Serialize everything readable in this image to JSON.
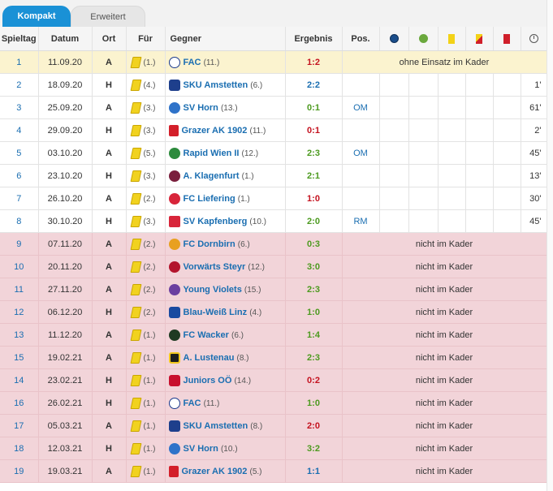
{
  "tabs": {
    "compact": "Kompakt",
    "extended": "Erweitert"
  },
  "headers": {
    "round": "Spieltag",
    "date": "Datum",
    "venue": "Ort",
    "for": "Für",
    "opponent": "Gegner",
    "result": "Ergebnis",
    "position": "Pos."
  },
  "header_icons": [
    "goals-ball-icon",
    "assists-icon",
    "yellow-card-icon",
    "yellow-red-card-icon",
    "red-card-icon",
    "clock-icon"
  ],
  "rows": [
    {
      "round": "1",
      "date": "11.09.20",
      "venue": "A",
      "for_rank": "(1.)",
      "opponent": "FAC",
      "opp_rank": "(11.)",
      "result": "1:2",
      "outcome": "loss",
      "position": "",
      "minutes": "",
      "note": "ohne Einsatz im Kader",
      "status": "highlight",
      "logo": "fac"
    },
    {
      "round": "2",
      "date": "18.09.20",
      "venue": "H",
      "for_rank": "(4.)",
      "opponent": "SKU Amstetten",
      "opp_rank": "(6.)",
      "result": "2:2",
      "outcome": "draw",
      "position": "",
      "minutes": "1'",
      "note": "",
      "status": "normal",
      "logo": "sku"
    },
    {
      "round": "3",
      "date": "25.09.20",
      "venue": "A",
      "for_rank": "(3.)",
      "opponent": "SV Horn",
      "opp_rank": "(13.)",
      "result": "0:1",
      "outcome": "win",
      "position": "OM",
      "minutes": "61'",
      "note": "",
      "status": "normal",
      "logo": "horn"
    },
    {
      "round": "4",
      "date": "29.09.20",
      "venue": "H",
      "for_rank": "(3.)",
      "opponent": "Grazer AK 1902",
      "opp_rank": "(11.)",
      "result": "0:1",
      "outcome": "loss",
      "position": "",
      "minutes": "2'",
      "note": "",
      "status": "normal",
      "logo": "gak"
    },
    {
      "round": "5",
      "date": "03.10.20",
      "venue": "A",
      "for_rank": "(5.)",
      "opponent": "Rapid Wien II",
      "opp_rank": "(12.)",
      "result": "2:3",
      "outcome": "win",
      "position": "OM",
      "minutes": "45'",
      "note": "",
      "status": "normal",
      "logo": "rapid"
    },
    {
      "round": "6",
      "date": "23.10.20",
      "venue": "H",
      "for_rank": "(3.)",
      "opponent": "A. Klagenfurt",
      "opp_rank": "(1.)",
      "result": "2:1",
      "outcome": "win",
      "position": "",
      "minutes": "13'",
      "note": "",
      "status": "normal",
      "logo": "klagenfurt"
    },
    {
      "round": "7",
      "date": "26.10.20",
      "venue": "A",
      "for_rank": "(2.)",
      "opponent": "FC Liefering",
      "opp_rank": "(1.)",
      "result": "1:0",
      "outcome": "loss",
      "position": "",
      "minutes": "30'",
      "note": "",
      "status": "normal",
      "logo": "liefering"
    },
    {
      "round": "8",
      "date": "30.10.20",
      "venue": "H",
      "for_rank": "(3.)",
      "opponent": "SV Kapfenberg",
      "opp_rank": "(10.)",
      "result": "2:0",
      "outcome": "win",
      "position": "RM",
      "minutes": "45'",
      "note": "",
      "status": "normal",
      "logo": "kapfenberg"
    },
    {
      "round": "9",
      "date": "07.11.20",
      "venue": "A",
      "for_rank": "(2.)",
      "opponent": "FC Dornbirn",
      "opp_rank": "(6.)",
      "result": "0:3",
      "outcome": "win",
      "position": "",
      "minutes": "",
      "note": "nicht im Kader",
      "status": "absent",
      "logo": "dornbirn"
    },
    {
      "round": "10",
      "date": "20.11.20",
      "venue": "A",
      "for_rank": "(2.)",
      "opponent": "Vorwärts Steyr",
      "opp_rank": "(12.)",
      "result": "3:0",
      "outcome": "win",
      "position": "",
      "minutes": "",
      "note": "nicht im Kader",
      "status": "absent",
      "logo": "steyr"
    },
    {
      "round": "11",
      "date": "27.11.20",
      "venue": "A",
      "for_rank": "(2.)",
      "opponent": "Young Violets",
      "opp_rank": "(15.)",
      "result": "2:3",
      "outcome": "win",
      "position": "",
      "minutes": "",
      "note": "nicht im Kader",
      "status": "absent",
      "logo": "violets"
    },
    {
      "round": "12",
      "date": "06.12.20",
      "venue": "H",
      "for_rank": "(2.)",
      "opponent": "Blau-Weiß Linz",
      "opp_rank": "(4.)",
      "result": "1:0",
      "outcome": "win",
      "position": "",
      "minutes": "",
      "note": "nicht im Kader",
      "status": "absent",
      "logo": "linz"
    },
    {
      "round": "13",
      "date": "11.12.20",
      "venue": "A",
      "for_rank": "(1.)",
      "opponent": "FC Wacker",
      "opp_rank": "(6.)",
      "result": "1:4",
      "outcome": "win",
      "position": "",
      "minutes": "",
      "note": "nicht im Kader",
      "status": "absent",
      "logo": "wacker"
    },
    {
      "round": "15",
      "date": "19.02.21",
      "venue": "A",
      "for_rank": "(1.)",
      "opponent": "A. Lustenau",
      "opp_rank": "(8.)",
      "result": "2:3",
      "outcome": "win",
      "position": "",
      "minutes": "",
      "note": "nicht im Kader",
      "status": "absent",
      "logo": "lustenau"
    },
    {
      "round": "14",
      "date": "23.02.21",
      "venue": "H",
      "for_rank": "(1.)",
      "opponent": "Juniors OÖ",
      "opp_rank": "(14.)",
      "result": "0:2",
      "outcome": "loss",
      "position": "",
      "minutes": "",
      "note": "nicht im Kader",
      "status": "absent",
      "logo": "juniors"
    },
    {
      "round": "16",
      "date": "26.02.21",
      "venue": "H",
      "for_rank": "(1.)",
      "opponent": "FAC",
      "opp_rank": "(11.)",
      "result": "1:0",
      "outcome": "win",
      "position": "",
      "minutes": "",
      "note": "nicht im Kader",
      "status": "absent",
      "logo": "fac"
    },
    {
      "round": "17",
      "date": "05.03.21",
      "venue": "A",
      "for_rank": "(1.)",
      "opponent": "SKU Amstetten",
      "opp_rank": "(8.)",
      "result": "2:0",
      "outcome": "loss",
      "position": "",
      "minutes": "",
      "note": "nicht im Kader",
      "status": "absent",
      "logo": "sku"
    },
    {
      "round": "18",
      "date": "12.03.21",
      "venue": "H",
      "for_rank": "(1.)",
      "opponent": "SV Horn",
      "opp_rank": "(10.)",
      "result": "3:2",
      "outcome": "win",
      "position": "",
      "minutes": "",
      "note": "nicht im Kader",
      "status": "absent",
      "logo": "horn"
    },
    {
      "round": "19",
      "date": "19.03.21",
      "venue": "A",
      "for_rank": "(1.)",
      "opponent": "Grazer AK 1902",
      "opp_rank": "(5.)",
      "result": "1:1",
      "outcome": "draw",
      "position": "",
      "minutes": "",
      "note": "nicht im Kader",
      "status": "absent",
      "logo": "gak"
    }
  ],
  "colors": {
    "tab_active": "#1a91d6",
    "row_highlight": "#fbf3cf",
    "row_absent": "#f2d4d9",
    "win": "#4c9a1f",
    "loss": "#c4121f",
    "draw": "#1a6eb1",
    "link": "#1a6eb1"
  }
}
